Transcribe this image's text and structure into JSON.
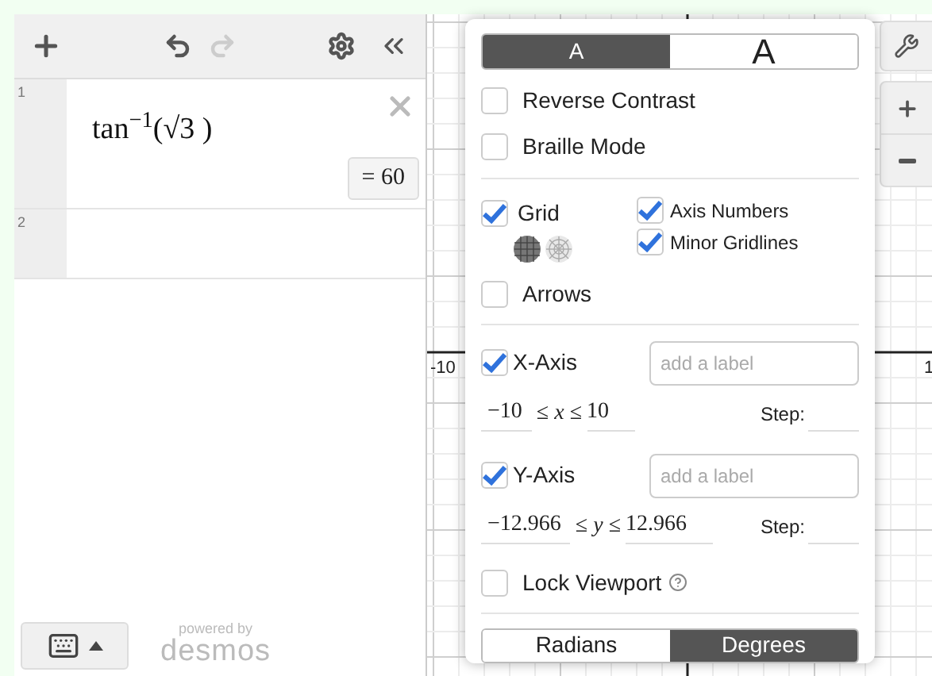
{
  "expressions": [
    {
      "index": "1",
      "latex": "tan$^{−1}$(√3 )",
      "result": "= 60"
    },
    {
      "index": "2"
    }
  ],
  "footer": {
    "powered_by": "powered by",
    "brand": "desmos"
  },
  "graph": {
    "axis_labels": [
      {
        "kind": "left",
        "text": "-10"
      },
      {
        "kind": "right",
        "text": "1"
      }
    ]
  },
  "settings": {
    "font_sizes": [
      {
        "label": "A",
        "kind": "small",
        "selected": true
      },
      {
        "label": "A",
        "kind": "large",
        "selected": false
      }
    ],
    "options": [
      {
        "label": "Reverse Contrast",
        "checked": false
      },
      {
        "label": "Braille Mode",
        "checked": false
      }
    ],
    "grid": {
      "label": "Grid",
      "checked": true,
      "types": [
        {
          "kind": "cartesian",
          "selected": true
        },
        {
          "kind": "polar",
          "selected": false
        }
      ]
    },
    "grid_options": [
      {
        "label": "Axis Numbers",
        "checked": true
      },
      {
        "label": "Minor Gridlines",
        "checked": true
      }
    ],
    "arrows": {
      "label": "Arrows",
      "checked": false
    },
    "axes": [
      {
        "label": "X-Axis",
        "checked": true,
        "placeholder": "add a label",
        "min": "−10",
        "relation": "≤ *x* ≤",
        "max": "10",
        "step_label": "Step:"
      },
      {
        "label": "Y-Axis",
        "checked": true,
        "placeholder": "add a label",
        "min": "−12.966",
        "relation": "≤ *y* ≤",
        "max": "12.966",
        "step_label": "Step:"
      }
    ],
    "lock_viewport": {
      "label": "Lock Viewport",
      "checked": false
    },
    "angle_modes": [
      {
        "label": "Radians",
        "selected": false
      },
      {
        "label": "Degrees",
        "selected": true
      }
    ]
  }
}
